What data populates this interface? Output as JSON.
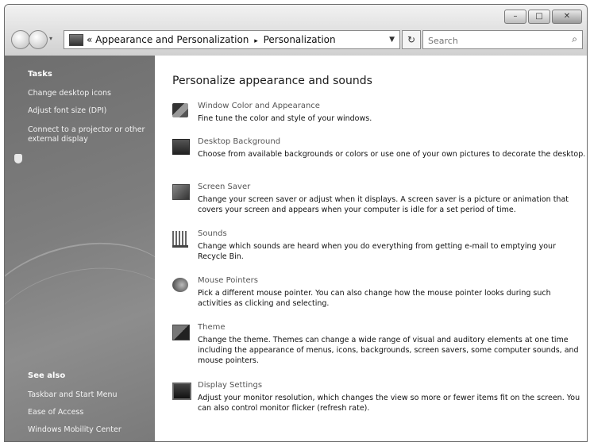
{
  "window": {
    "title_buttons": [
      "minimize",
      "maximize",
      "close"
    ]
  },
  "nav": {
    "breadcrumb_prefix": "«",
    "breadcrumb": [
      "Appearance and Personalization",
      "Personalization"
    ],
    "separator": "▸",
    "search_placeholder": "Search"
  },
  "sidebar": {
    "tasks_heading": "Tasks",
    "tasks": [
      "Change desktop icons",
      "Adjust font size (DPI)",
      "Connect to a projector or other external display"
    ],
    "see_also_heading": "See also",
    "see_also": [
      "Taskbar and Start Menu",
      "Ease of Access",
      "Windows Mobility Center"
    ]
  },
  "main": {
    "title": "Personalize appearance and sounds",
    "items": [
      {
        "icon": "window-color-icon",
        "title": "Window Color and Appearance",
        "desc": "Fine tune the color and style of your windows."
      },
      {
        "icon": "desktop-background-icon",
        "title": "Desktop Background",
        "desc": "Choose from available backgrounds or colors or use one of your own pictures to decorate the desktop."
      },
      {
        "icon": "screen-saver-icon",
        "title": "Screen Saver",
        "desc": "Change your screen saver or adjust when it displays. A screen saver is a picture or animation that covers your screen and appears when your computer is idle for a set period of time."
      },
      {
        "icon": "sounds-icon",
        "title": "Sounds",
        "desc": "Change which sounds are heard when you do everything from getting e-mail to emptying your Recycle Bin."
      },
      {
        "icon": "mouse-pointer-icon",
        "title": "Mouse Pointers",
        "desc": "Pick a different mouse pointer. You can also change how the mouse pointer looks during such activities as clicking and selecting."
      },
      {
        "icon": "theme-icon",
        "title": "Theme",
        "desc": "Change the theme. Themes can change a wide range of visual and auditory elements at one time including the appearance of menus, icons, backgrounds, screen savers, some computer sounds, and mouse pointers."
      },
      {
        "icon": "display-icon",
        "title": "Display Settings",
        "desc": "Adjust your monitor resolution, which changes the view so more or fewer items fit on the screen. You can also control monitor flicker (refresh rate)."
      }
    ]
  }
}
